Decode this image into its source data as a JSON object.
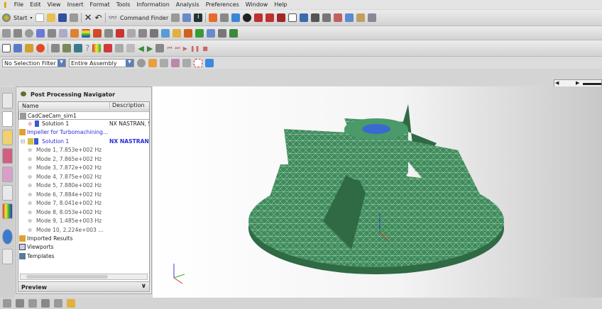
{
  "menu": [
    "File",
    "Edit",
    "View",
    "Insert",
    "Format",
    "Tools",
    "Information",
    "Analysis",
    "Preferences",
    "Window",
    "Help"
  ],
  "toolbar": {
    "start_label": "Start",
    "command_finder_label": "Command Finder"
  },
  "filters": {
    "selection_filter": "No Selection Filter",
    "assembly_scope": "Entire Assembly"
  },
  "navigator": {
    "title": "Post Processing Navigator",
    "columns": [
      "Name",
      "Description"
    ],
    "sim": "CadCaeCam_sim1",
    "solution_a": {
      "name": "Solution 1",
      "description": "NX NASTRAN, S"
    },
    "model": "Impeller for Turbomachining...",
    "solution_b": {
      "name": "Solution 1",
      "description": "NX NASTRAN, S"
    },
    "modes": [
      "Mode 1,  7.853e+002 Hz",
      "Mode 2,  7.865e+002 Hz",
      "Mode 3,  7.872e+002 Hz",
      "Mode 4,  7.875e+002 Hz",
      "Mode 5,  7.880e+002 Hz",
      "Mode 6,  7.884e+002 Hz",
      "Mode 7,  8.041e+002 Hz",
      "Mode 8,  8.053e+002 Hz",
      "Mode 9,  1.485e+003 Hz",
      "Mode 10,  2.224e+003 ..."
    ],
    "imported": "Imported Results",
    "viewports": "Viewports",
    "templates": "Templates",
    "preview": "Preview"
  },
  "colors": {
    "mesh": "#3f8a5c",
    "selected": "#2a2ad8"
  }
}
